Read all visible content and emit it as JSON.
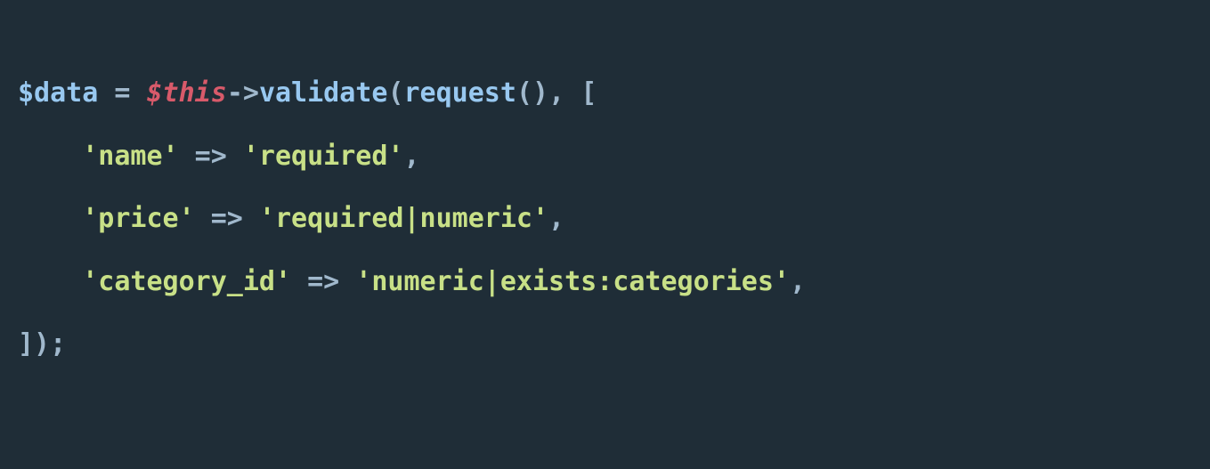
{
  "code": {
    "line1": {
      "var": "$data",
      "eq": " = ",
      "this": "$this",
      "arrow": "->",
      "fn1": "validate",
      "paren1": "(",
      "fn2": "request",
      "paren2": "()",
      "comma": ", ",
      "bracket": "["
    },
    "line2": {
      "indent": "    ",
      "key": "'name'",
      "fat": " => ",
      "val": "'required'",
      "comma": ","
    },
    "line3": {
      "indent": "    ",
      "key": "'price'",
      "fat": " => ",
      "val": "'required|numeric'",
      "comma": ","
    },
    "line4": {
      "indent": "    ",
      "key": "'category_id'",
      "fat": " => ",
      "val": "'numeric|exists:categories'",
      "comma": ","
    },
    "line5": {
      "close": "]);"
    }
  }
}
